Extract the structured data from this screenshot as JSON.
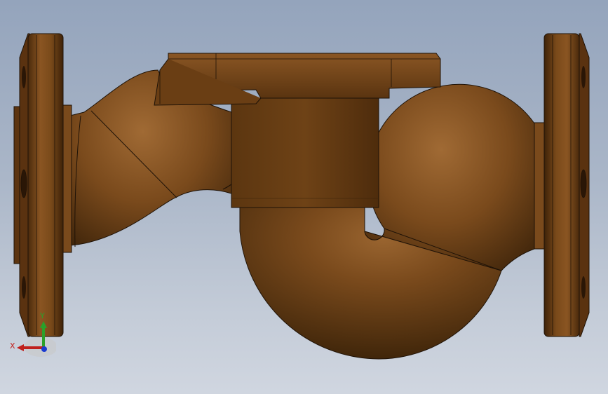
{
  "viewport": {
    "background_top": "#94a4bc",
    "background_bottom": "#d0d6e0"
  },
  "model": {
    "part": "pipe-trap-with-flanges",
    "material_color": "#7a4a1c",
    "edge_color": "#1e1207"
  },
  "triad": {
    "x_label": "X",
    "y_label": "Y",
    "x_color": "#c0201c",
    "y_color": "#2aa02a",
    "z_color": "#1a3ad0"
  }
}
